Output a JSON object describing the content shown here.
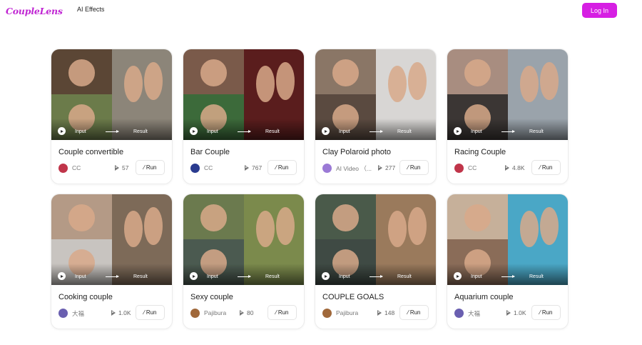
{
  "header": {
    "logo": "CoupleLens",
    "nav_ai_effects": "AI Effects",
    "login_label": "Log In"
  },
  "cards": [
    {
      "title": "Couple convertible",
      "author": "CC",
      "plays": "57",
      "run_label": "Run",
      "input_label": "Input",
      "result_label": "Result",
      "colors": {
        "q1": "#5b4635",
        "q2": "#6b7b4a",
        "q3": "#8c8579",
        "avatar": "#c0354a"
      }
    },
    {
      "title": "Bar Couple",
      "author": "CC",
      "plays": "767",
      "run_label": "Run",
      "input_label": "Input",
      "result_label": "Result",
      "colors": {
        "q1": "#7a5a4a",
        "q2": "#3c6a3a",
        "q3": "#5a1d1d",
        "avatar": "#2a3b8f"
      }
    },
    {
      "title": "Clay Polaroid photo",
      "author": "AI Video （...",
      "plays": "277",
      "run_label": "Run",
      "input_label": "Input",
      "result_label": "Result",
      "colors": {
        "q1": "#8a7666",
        "q2": "#5a4a40",
        "q3": "#d8d6d4",
        "avatar": "#9b7ad6"
      }
    },
    {
      "title": "Racing Couple",
      "author": "CC",
      "plays": "4.8K",
      "run_label": "Run",
      "input_label": "Input",
      "result_label": "Result",
      "colors": {
        "q1": "#a88d80",
        "q2": "#3b3634",
        "q3": "#9aa3ab",
        "avatar": "#c0354a"
      }
    },
    {
      "title": "Cooking couple",
      "author": "大福",
      "plays": "1.0K",
      "run_label": "Run",
      "input_label": "Input",
      "result_label": "Result",
      "colors": {
        "q1": "#b49a86",
        "q2": "#c8c4c0",
        "q3": "#7d6a58",
        "avatar": "#6a5fb0"
      }
    },
    {
      "title": "Sexy couple",
      "author": "Pajibura",
      "plays": "80",
      "run_label": "Run",
      "input_label": "Input",
      "result_label": "Result",
      "colors": {
        "q1": "#6b7a4e",
        "q2": "#4b5a50",
        "q3": "#7b8a4c",
        "avatar": "#a0683a"
      }
    },
    {
      "title": "COUPLE GOALS",
      "author": "Pajibura",
      "plays": "148",
      "run_label": "Run",
      "input_label": "Input",
      "result_label": "Result",
      "colors": {
        "q1": "#4a5a4a",
        "q2": "#3f4a44",
        "q3": "#9a7a5c",
        "avatar": "#a0683a"
      }
    },
    {
      "title": "Aquarium couple",
      "author": "大福",
      "plays": "1.0K",
      "run_label": "Run",
      "input_label": "Input",
      "result_label": "Result",
      "colors": {
        "q1": "#c6b09a",
        "q2": "#8a6c58",
        "q3": "#4aa7c6",
        "avatar": "#6a5fb0"
      }
    }
  ]
}
